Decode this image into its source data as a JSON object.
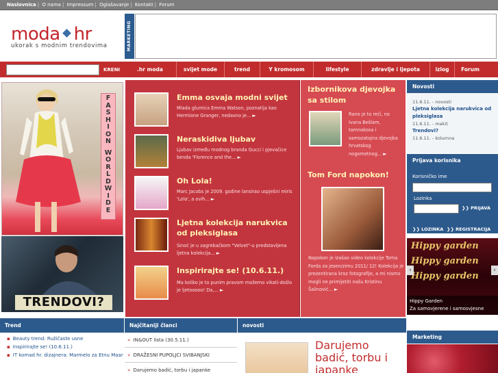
{
  "topbar": {
    "items": [
      "Naslovnica",
      "O nama",
      "Impressum",
      "Oglašavanje",
      "Kontakt",
      "Forum"
    ]
  },
  "header": {
    "logo_word_left": "moda",
    "logo_word_right": "hr",
    "tagline": "ukorak s modnim trendovima",
    "marketing_tab": "MARKETING"
  },
  "nav": {
    "search_button": "KRENI",
    "items": [
      ".hr moda",
      "svijet mode",
      "trend",
      "Y kromosom",
      "lifestyle",
      "zdravlje i ljepota",
      "izlog",
      "Forum"
    ]
  },
  "left": {
    "fashion_letters_1": [
      "F",
      "A",
      "S",
      "H",
      "I",
      "O",
      "N"
    ],
    "fashion_letters_2": [
      "W",
      "O",
      "R",
      "L",
      "D",
      "W",
      "I",
      "D",
      "E"
    ],
    "trend_banner": "TRENDOVI?"
  },
  "features": [
    {
      "title": "Emma osvaja modni svijet",
      "desc": "Mlada glumica Emma Watson, poznatija kao Hermione Granger, nedavno je..."
    },
    {
      "title": "Neraskidiva ljubav",
      "desc": "Ljubav između modnog branda Gucci i pjevačice benda 'Florence and the..."
    },
    {
      "title": "Oh Lola!",
      "desc": "Marc Jacobs je 2009. godine lansirao uspješni miris 'Lola', a ovih..."
    },
    {
      "title": "Ljetna kolekcija narukvica od pleksiglasa",
      "desc": "Sinoć je u zagrebačkom \"Velvet\"-u predstavljena ljetna kolekcija..."
    },
    {
      "title": "Inspirirajte se! (10.6.11.)",
      "desc": "Ma koliko je to punim pravom možemo vikati-došlo je ljetooooo! Da,..."
    }
  ],
  "right_center": {
    "story1_title": "Izbornikova djevojka sa stilom",
    "story1_desc": "Rano je to reći, no Ivana Bešlam, tamnokosa i samozatajna djevojka hrvatskog nogometnog...",
    "story2_title": "Tom Ford napokon!",
    "story2_desc": "Napokon je izašao video kolekcije Toma Forda za jesen/zimu 2011/ 12! Kolekcija je prezentirana kroz fotografije, a mi nismo mogli ne primijetiti našu Kristinu Šalinović..."
  },
  "sidebar": {
    "news_header": "Novosti",
    "news": [
      {
        "date": "11.6.11. - novosti",
        "link": "Ljetna kolekcija narukvica od pleksiglasa"
      },
      {
        "date": "11.6.11. - makit",
        "link": "Trendovi?"
      },
      {
        "date": "11.6.11. - kolumna",
        "link": ""
      }
    ],
    "login_header": "Prijava korisnika",
    "username_label": "Korisničko ime",
    "password_label": "Lozinka",
    "login_button": "PRIJAVA",
    "forgot_link": "LOZINKA",
    "register_link": "REGISTRACIJA",
    "hippy_script": "Hippy garden",
    "hippy_title": "Hippy Garden",
    "hippy_desc": "Za samovjerene i samosvjesne",
    "marketing_header": "Marketing"
  },
  "bottom": {
    "trend_header": "Trend",
    "trend_items": [
      "Beauty trend: Ružičaste usne",
      "Inspirirajte se! (10.6.11.)",
      "IT komad hr. dizajnera: Marmelo za Etnu Maar"
    ],
    "read_header": "Najčitaniji članci",
    "read_items": [
      "IN&OUT lista (30.5.11.)",
      "DRAŽESNI PUPOLJCI SVIBANJSKI",
      "Darujemo badić, torbu i japanke"
    ],
    "news_header": "novosti",
    "news_title": "Darujemo badić, torbu i japanke"
  },
  "colors": {
    "brand_red": "#c22c2c",
    "brand_blue": "#2d5a8c",
    "feature_bg": "#c3353e",
    "title_yellow": "#fff3b5"
  }
}
